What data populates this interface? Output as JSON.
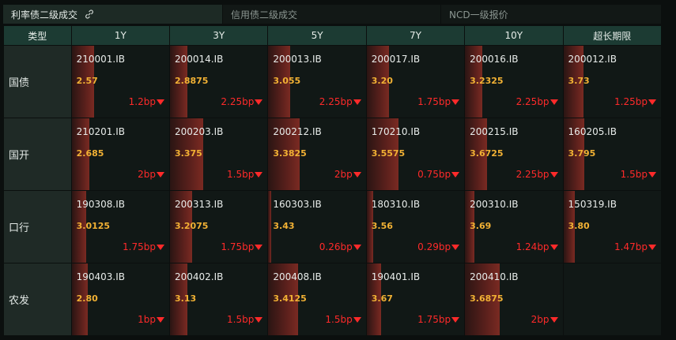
{
  "tabs": [
    {
      "label": "利率债二级成交",
      "active": true
    },
    {
      "label": "信用债二级成交",
      "active": false
    },
    {
      "label": "NCD一级报价",
      "active": false
    }
  ],
  "columns": [
    "类型",
    "1Y",
    "3Y",
    "5Y",
    "7Y",
    "10Y",
    "超长期限"
  ],
  "rows": [
    {
      "label": "国债",
      "cells": [
        {
          "code": "210001.IB",
          "value": "2.57",
          "change": "1.2bp"
        },
        {
          "code": "200014.IB",
          "value": "2.8875",
          "change": "2.25bp"
        },
        {
          "code": "200013.IB",
          "value": "3.055",
          "change": "2.25bp"
        },
        {
          "code": "200017.IB",
          "value": "3.20",
          "change": "1.75bp"
        },
        {
          "code": "200016.IB",
          "value": "3.2325",
          "change": "2.25bp"
        },
        {
          "code": "200012.IB",
          "value": "3.73",
          "change": "1.25bp"
        }
      ]
    },
    {
      "label": "国开",
      "cells": [
        {
          "code": "210201.IB",
          "value": "2.685",
          "change": "2bp"
        },
        {
          "code": "200203.IB",
          "value": "3.375",
          "change": "1.5bp"
        },
        {
          "code": "200212.IB",
          "value": "3.3825",
          "change": "2bp"
        },
        {
          "code": "170210.IB",
          "value": "3.5575",
          "change": "0.75bp"
        },
        {
          "code": "200215.IB",
          "value": "3.6725",
          "change": "2.25bp"
        },
        {
          "code": "160205.IB",
          "value": "3.795",
          "change": "1.5bp"
        }
      ]
    },
    {
      "label": "口行",
      "cells": [
        {
          "code": "190308.IB",
          "value": "3.0125",
          "change": "1.75bp"
        },
        {
          "code": "200313.IB",
          "value": "3.2075",
          "change": "1.75bp"
        },
        {
          "code": "160303.IB",
          "value": "3.43",
          "change": "0.26bp"
        },
        {
          "code": "180310.IB",
          "value": "3.56",
          "change": "0.29bp"
        },
        {
          "code": "200310.IB",
          "value": "3.69",
          "change": "1.24bp"
        },
        {
          "code": "150319.IB",
          "value": "3.80",
          "change": "1.47bp"
        }
      ]
    },
    {
      "label": "农发",
      "cells": [
        {
          "code": "190403.IB",
          "value": "2.80",
          "change": "1bp"
        },
        {
          "code": "200402.IB",
          "value": "3.13",
          "change": "1.5bp"
        },
        {
          "code": "200408.IB",
          "value": "3.4125",
          "change": "1.5bp"
        },
        {
          "code": "190401.IB",
          "value": "3.67",
          "change": "1.75bp"
        },
        {
          "code": "200410.IB",
          "value": "3.6875",
          "change": "2bp"
        },
        null
      ]
    }
  ],
  "colors": {
    "down": "#ff2a2a",
    "value": "#f2b134",
    "header": "#1c3b33"
  },
  "icons": {
    "tab_link": "link-icon",
    "change": "down-arrow-icon"
  }
}
